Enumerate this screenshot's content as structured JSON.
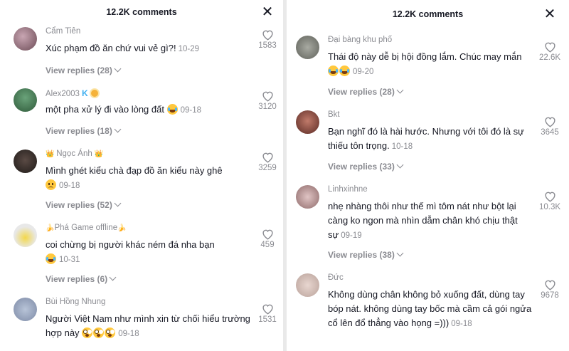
{
  "left_panel": {
    "title": "12.2K comments",
    "comments": [
      {
        "username": "Cẩm Tiên",
        "text": "Xúc phạm đồ ăn chứ vui vẻ gì?!",
        "date": "10-29",
        "likes": "1583",
        "replies": "View replies (28)"
      },
      {
        "username": "Alex2003",
        "text": "một pha xử lý đi vào lòng đất",
        "date": "09-18",
        "likes": "3120",
        "replies": "View replies (18)"
      },
      {
        "username": "Ngọc Ánh",
        "text": "Mình ghét kiểu chà đạp đồ ăn kiểu này ghê",
        "date": "09-18",
        "likes": "3259",
        "replies": "View replies (52)"
      },
      {
        "username": "Phá Game offline",
        "text": "coi chừng bị người khác ném đá nha bạn",
        "date": "10-31",
        "likes": "459",
        "replies": "View replies (6)"
      },
      {
        "username": "Bùi Hồng Nhung",
        "text": "Người Việt Nam như mình xin từ chối hiểu trường hợp này",
        "date": "09-18",
        "likes": "1531"
      }
    ]
  },
  "right_panel": {
    "title": "12.2K comments",
    "comments": [
      {
        "username": "Đại bàng khu phố",
        "text": "Thái độ này dễ bị hội đồng lắm. Chúc may mắn",
        "date": "09-20",
        "likes": "22.6K",
        "replies": "View replies (28)"
      },
      {
        "username": "Bkt",
        "text": "Bạn nghĩ đó là hài hước. Nhưng với tôi đó là sự thiếu tôn trọng.",
        "date": "10-18",
        "likes": "3645",
        "replies": "View replies (33)"
      },
      {
        "username": "Linhxinhne",
        "text": "nhẹ nhàng thôi như thế mì tôm nát như bột lại càng ko ngon mà nhìn dẫm chân khó chịu thật sự",
        "date": "09-19",
        "likes": "10.3K",
        "replies": "View replies (38)"
      },
      {
        "username": "Đức",
        "text": "Không dùng chân không bỏ xuống đất, dùng tay bóp nát. không dùng tay bốc mà cầm cả gói ngửa cổ lên đổ thẳng vào họng =)))",
        "date": "09-18",
        "likes": "9678"
      }
    ]
  },
  "icons": {
    "close": "close-icon",
    "like": "heart-outline-icon",
    "expand": "chevron-down-icon",
    "verified_k": "K"
  },
  "colors": {
    "text": "#161823",
    "muted": "#8a8b91",
    "background": "#ffffff"
  }
}
